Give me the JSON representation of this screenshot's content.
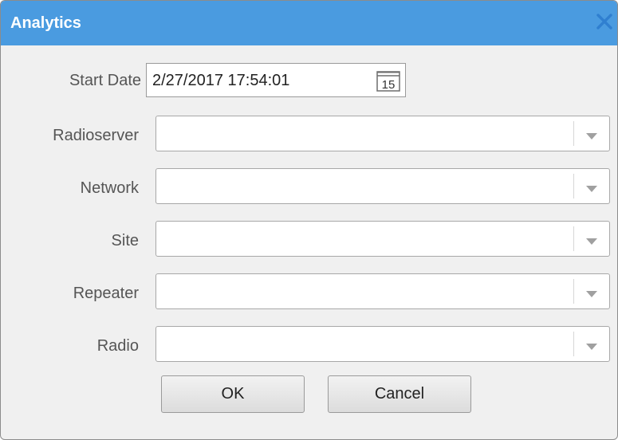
{
  "dialog": {
    "title": "Analytics",
    "icons": {
      "close": "close-icon",
      "calendar": "calendar-icon",
      "dropdown": "chevron-down-icon"
    },
    "colors": {
      "titlebar": "#4a9be0",
      "close": "#2f7fd0"
    }
  },
  "start_date": {
    "label": "Start Date",
    "value": "2/27/2017 17:54:01",
    "calendar_day": "15"
  },
  "fields": {
    "radioserver": {
      "label": "Radioserver",
      "value": ""
    },
    "network": {
      "label": "Network",
      "value": ""
    },
    "site": {
      "label": "Site",
      "value": ""
    },
    "repeater": {
      "label": "Repeater",
      "value": ""
    },
    "radio": {
      "label": "Radio",
      "value": ""
    }
  },
  "buttons": {
    "ok": "OK",
    "cancel": "Cancel"
  }
}
